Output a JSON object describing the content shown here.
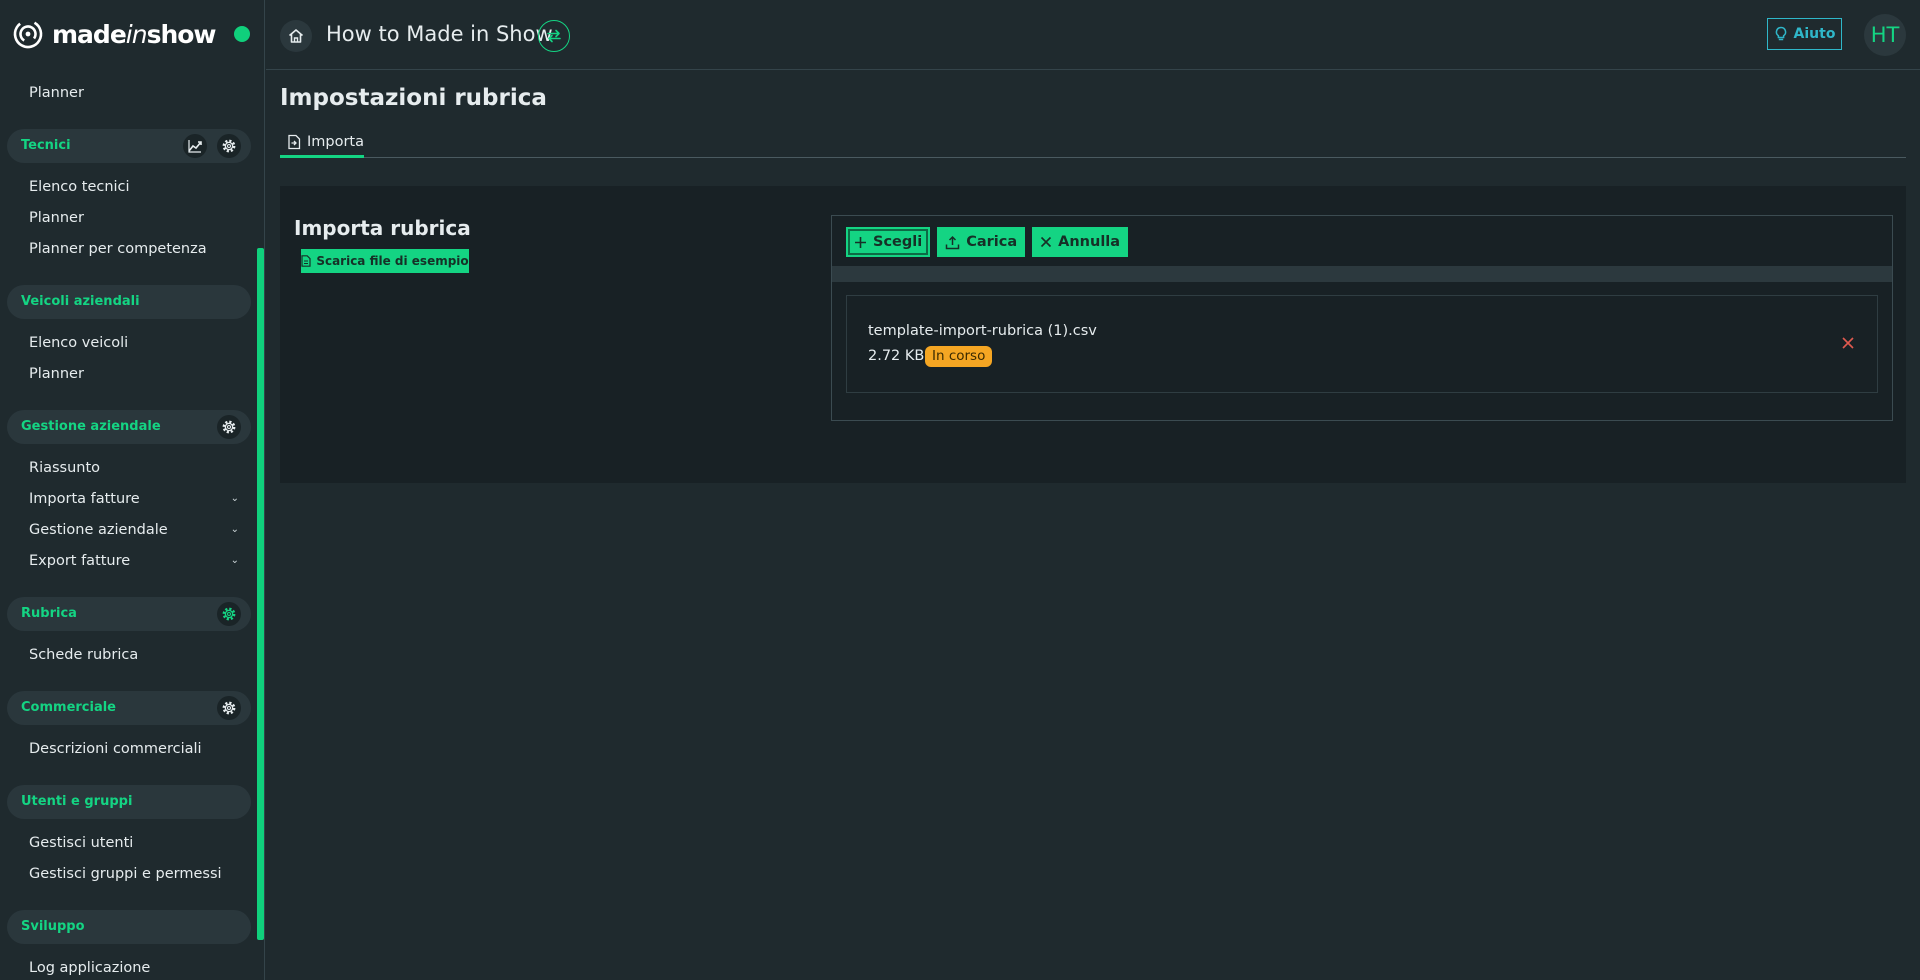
{
  "brand": {
    "name_a": "made",
    "name_b": "in",
    "name_c": "show"
  },
  "header": {
    "title": "How to Made in Show",
    "help_label": "Aiuto",
    "avatar_initials": "HT"
  },
  "colors": {
    "accent": "#14d483",
    "warning": "#f5a623",
    "help": "#2fb7c9",
    "danger": "#e05a4f"
  },
  "sidebar": {
    "top_item": "Planner",
    "sections": [
      {
        "label": "Tecnici",
        "items": [
          "Elenco tecnici",
          "Planner",
          "Planner per competenza"
        ]
      },
      {
        "label": "Veicoli aziendali",
        "items": [
          "Elenco veicoli",
          "Planner"
        ]
      },
      {
        "label": "Gestione aziendale",
        "items": [
          "Riassunto",
          "Importa fatture",
          "Gestione aziendale",
          "Export fatture"
        ]
      },
      {
        "label": "Rubrica",
        "items": [
          "Schede rubrica"
        ]
      },
      {
        "label": "Commerciale",
        "items": [
          "Descrizioni commerciali"
        ]
      },
      {
        "label": "Utenti e gruppi",
        "items": [
          "Gestisci utenti",
          "Gestisci gruppi e permessi"
        ]
      },
      {
        "label": "Sviluppo",
        "items": [
          "Log applicazione"
        ]
      }
    ]
  },
  "main": {
    "page_title": "Impostazioni rubrica",
    "tabs": [
      {
        "label": "Importa"
      }
    ],
    "card": {
      "title": "Importa rubrica",
      "sample_button": "Scarica file di esempio",
      "upload": {
        "choose_label": "Scegli",
        "upload_label": "Carica",
        "cancel_label": "Annulla",
        "file": {
          "name": "template-import-rubrica (1).csv",
          "size": "2.72 KB",
          "status": "In corso"
        }
      }
    }
  }
}
